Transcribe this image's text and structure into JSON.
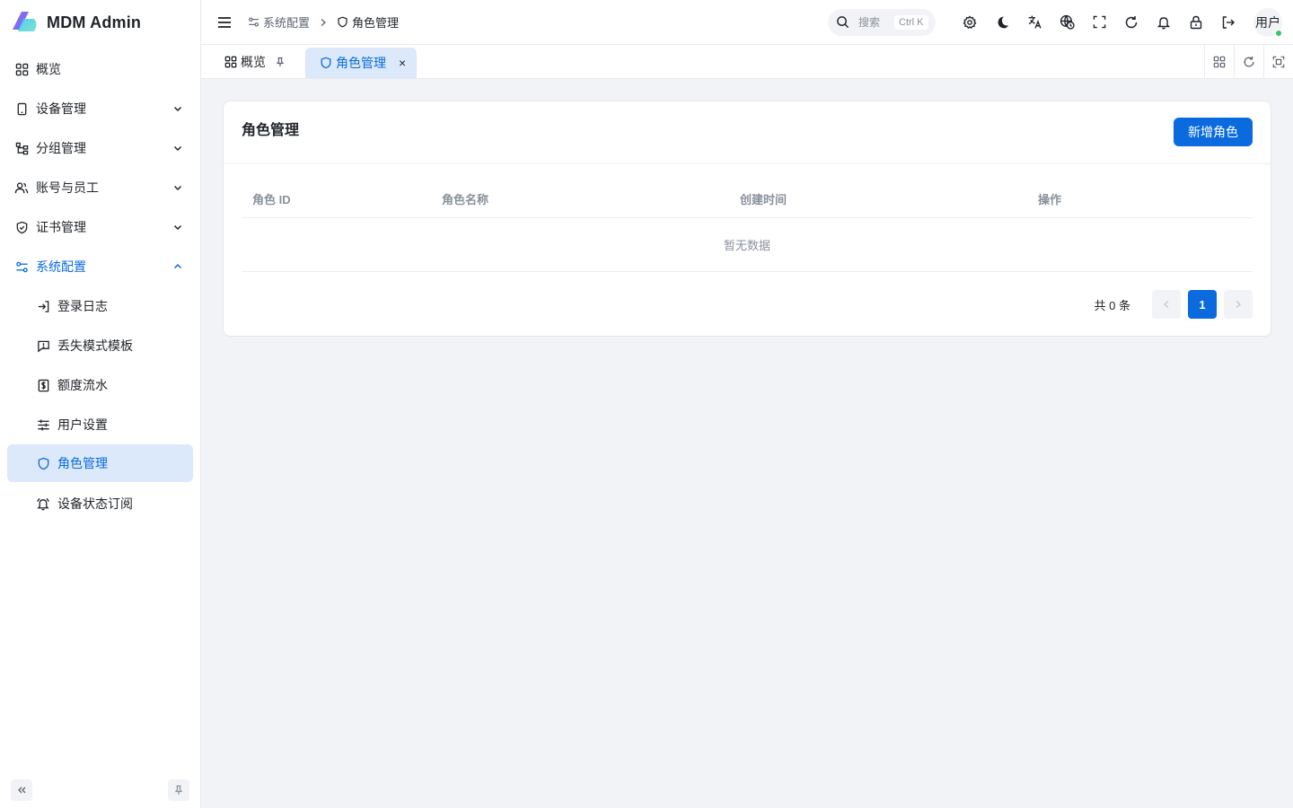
{
  "app": {
    "title": "MDM Admin"
  },
  "sidebar": {
    "items": [
      {
        "label": "概览",
        "icon": "dashboard-icon"
      },
      {
        "label": "设备管理",
        "icon": "device-icon"
      },
      {
        "label": "分组管理",
        "icon": "group-icon"
      },
      {
        "label": "账号与员工",
        "icon": "users-icon"
      },
      {
        "label": "证书管理",
        "icon": "certificate-icon"
      },
      {
        "label": "系统配置",
        "icon": "settings-sliders-icon"
      }
    ],
    "submenu": [
      {
        "label": "登录日志",
        "icon": "login-icon"
      },
      {
        "label": "丢失模式模板",
        "icon": "message-alert-icon"
      },
      {
        "label": "额度流水",
        "icon": "receipt-icon"
      },
      {
        "label": "用户设置",
        "icon": "sliders-icon"
      },
      {
        "label": "角色管理",
        "icon": "shield-icon"
      },
      {
        "label": "设备状态订阅",
        "icon": "bell-ring-icon"
      }
    ]
  },
  "header": {
    "breadcrumb": [
      "系统配置",
      "角色管理"
    ],
    "search": {
      "placeholder": "搜索",
      "shortcut": "Ctrl K"
    },
    "user": "用户"
  },
  "tabs": [
    {
      "label": "概览"
    },
    {
      "label": "角色管理",
      "close": "×"
    }
  ],
  "main": {
    "title": "角色管理",
    "add_button": "新增角色",
    "columns": [
      "角色 ID",
      "角色名称",
      "创建时间",
      "操作"
    ],
    "empty_text": "暂无数据",
    "pagination": {
      "total_text": "共 0 条",
      "current_page": "1"
    }
  },
  "colors": {
    "accent": "#0b6bde",
    "active_bg": "#dbe9fb",
    "status_online": "#35c46e"
  }
}
